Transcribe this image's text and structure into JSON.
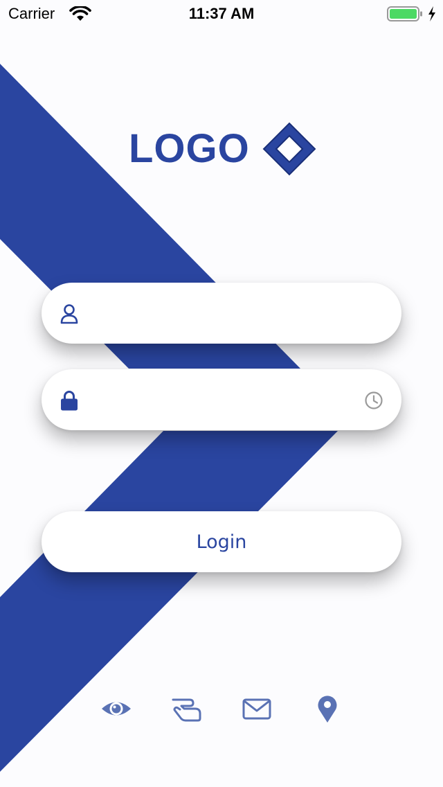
{
  "status_bar": {
    "carrier": "Carrier",
    "time": "11:37 AM",
    "battery_color": "#4cd964"
  },
  "logo": {
    "text": "LOGO",
    "color": "#2a45a0"
  },
  "username_field": {
    "icon": "user-icon",
    "value": "",
    "placeholder": ""
  },
  "password_field": {
    "icon": "lock-icon",
    "trailing_icon": "clock-icon",
    "value": "",
    "placeholder": ""
  },
  "login_button": {
    "label": "Login"
  },
  "bottom_icons": [
    {
      "name": "eye-icon"
    },
    {
      "name": "hand-icon"
    },
    {
      "name": "envelope-icon"
    },
    {
      "name": "location-pin-icon"
    }
  ],
  "colors": {
    "brand": "#2a45a0",
    "icon_muted": "#5a72b4",
    "background": "#fcfcfe"
  }
}
